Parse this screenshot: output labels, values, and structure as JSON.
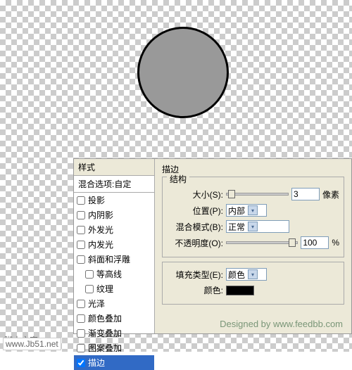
{
  "styles": {
    "header": "样式",
    "blendOption": "混合选项:自定",
    "items": [
      {
        "label": "投影",
        "checked": false,
        "indent": false
      },
      {
        "label": "内阴影",
        "checked": false,
        "indent": false
      },
      {
        "label": "外发光",
        "checked": false,
        "indent": false
      },
      {
        "label": "内发光",
        "checked": false,
        "indent": false
      },
      {
        "label": "斜面和浮雕",
        "checked": false,
        "indent": false
      },
      {
        "label": "等高线",
        "checked": false,
        "indent": true
      },
      {
        "label": "纹理",
        "checked": false,
        "indent": true
      },
      {
        "label": "光泽",
        "checked": false,
        "indent": false
      },
      {
        "label": "颜色叠加",
        "checked": false,
        "indent": false
      },
      {
        "label": "渐变叠加",
        "checked": false,
        "indent": false
      },
      {
        "label": "图案叠加",
        "checked": false,
        "indent": false
      },
      {
        "label": "描边",
        "checked": true,
        "indent": false,
        "active": true
      }
    ]
  },
  "stroke": {
    "title": "描边",
    "structure": {
      "label": "结构",
      "size": {
        "label": "大小(S):",
        "value": "3",
        "unit": "像素"
      },
      "position": {
        "label": "位置(P):",
        "value": "内部"
      },
      "blendMode": {
        "label": "混合模式(B):",
        "value": "正常"
      },
      "opacity": {
        "label": "不透明度(O):",
        "value": "100",
        "unit": "%"
      }
    },
    "fill": {
      "fillType": {
        "label": "填充类型(E):",
        "value": "颜色"
      },
      "color": {
        "label": "颜色:",
        "value": "#000000"
      }
    }
  },
  "watermark": "Designed by www.feedbb.com",
  "footer": {
    "label": "脚本之家",
    "url": "www.Jb51.net"
  }
}
